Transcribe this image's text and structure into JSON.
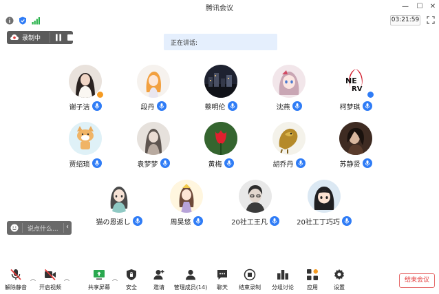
{
  "window": {
    "title": "腾讯会议"
  },
  "info_bar": {
    "timer": "03:21:59"
  },
  "recording": {
    "label": "录制中"
  },
  "speaking": {
    "label": "正在讲话:"
  },
  "participants": [
    {
      "name": "谢子洁",
      "avatar": "photo-girl-avatar",
      "badge": "host"
    },
    {
      "name": "段丹",
      "avatar": "anime-girl-avatar",
      "badge": ""
    },
    {
      "name": "蔡明伦",
      "avatar": "night-city-avatar",
      "badge": ""
    },
    {
      "name": "沈燕",
      "avatar": "anime-girl-2-avatar",
      "badge": ""
    },
    {
      "name": "柯梦琪",
      "avatar": "nerv-logo-avatar",
      "badge": "cohost"
    },
    {
      "name": "贾绍琐",
      "avatar": "shiba-dog-avatar",
      "badge": ""
    },
    {
      "name": "袁梦梦",
      "avatar": "sketch-girl-avatar",
      "badge": ""
    },
    {
      "name": "黄梅",
      "avatar": "red-tulip-avatar",
      "badge": ""
    },
    {
      "name": "胡乔丹",
      "avatar": "golden-dragon-avatar",
      "badge": ""
    },
    {
      "name": "苏静贤",
      "avatar": "dark-portrait-avatar",
      "badge": ""
    },
    {
      "name": "猫の恩返し",
      "avatar": "drawn-girl-avatar",
      "badge": ""
    },
    {
      "name": "周昊悠",
      "avatar": "chibi-girl-avatar",
      "badge": ""
    },
    {
      "name": "20社工王凡",
      "avatar": "sketch-boy-avatar",
      "badge": ""
    },
    {
      "name": "20社工丁巧巧",
      "avatar": "cartoon-girl-avatar",
      "badge": ""
    }
  ],
  "chat": {
    "placeholder": "说点什么..."
  },
  "toolbar": {
    "unmute": "解除静音",
    "start_video": "开启视频",
    "share_screen": "共享屏幕",
    "security": "安全",
    "invite": "邀请",
    "manage_members": "管理成员(14)",
    "chat": "聊天",
    "end_recording": "结束录制",
    "breakout": "分组讨论",
    "apps": "应用",
    "settings": "设置",
    "end_meeting": "结束会议"
  },
  "colors": {
    "accent_blue": "#2f7cf6",
    "mic_muted_red": "#e33b3b",
    "speaking_bg": "#e5effd",
    "end_meeting_red": "#e33b3b",
    "host_badge": "#f59b23"
  }
}
